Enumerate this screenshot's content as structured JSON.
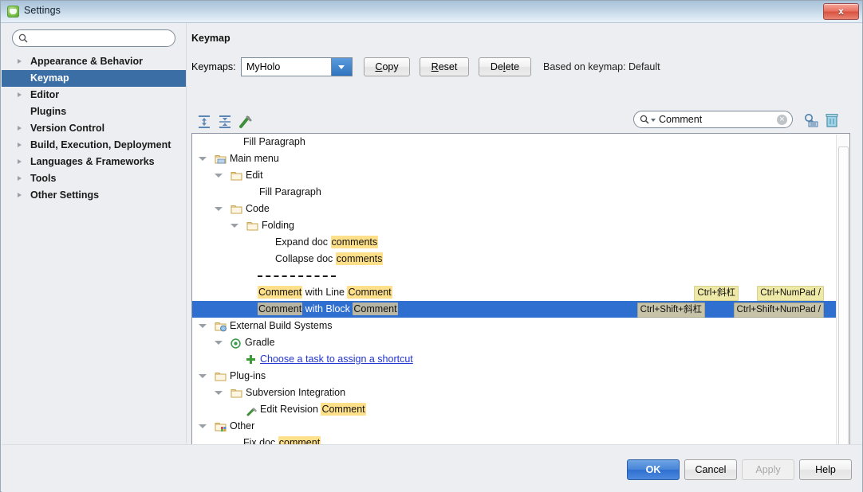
{
  "window": {
    "title": "Settings",
    "icon": "app-icon",
    "close_label": "x"
  },
  "sidebar": {
    "search_placeholder": "",
    "search_value": "",
    "items": [
      {
        "label": "Appearance & Behavior",
        "expandable": true,
        "selected": false
      },
      {
        "label": "Keymap",
        "expandable": false,
        "selected": true
      },
      {
        "label": "Editor",
        "expandable": true,
        "selected": false
      },
      {
        "label": "Plugins",
        "expandable": false,
        "selected": false
      },
      {
        "label": "Version Control",
        "expandable": true,
        "selected": false
      },
      {
        "label": "Build, Execution, Deployment",
        "expandable": true,
        "selected": false
      },
      {
        "label": "Languages & Frameworks",
        "expandable": true,
        "selected": false
      },
      {
        "label": "Tools",
        "expandable": true,
        "selected": false
      },
      {
        "label": "Other Settings",
        "expandable": true,
        "selected": false
      }
    ]
  },
  "main": {
    "page_title": "Keymap",
    "keymaps_label": "Keymaps:",
    "keymap_value": "MyHolo",
    "buttons": {
      "copy": "Copy",
      "reset": "Reset",
      "delete": "Delete"
    },
    "based_on": "Based on keymap: Default",
    "toolbar": {
      "expand_all": "expand-all-icon",
      "collapse_all": "collapse-all-icon",
      "edit_shortcut": "edit-shortcut-icon",
      "find_by_shortcut": "find-by-shortcut-icon",
      "reset_shortcuts": "trash-icon"
    },
    "search": {
      "value": "Comment",
      "clear": "×"
    }
  },
  "tree": {
    "rows": [
      {
        "indent": 64,
        "text": "Fill Paragraph",
        "highlight": null,
        "type": "action",
        "selected": false
      },
      {
        "indent": 8,
        "text": "Main menu",
        "highlight": null,
        "type": "group-menu",
        "expanded": true,
        "selected": false
      },
      {
        "indent": 28,
        "text": "Edit",
        "highlight": null,
        "type": "folder",
        "expanded": true,
        "selected": false
      },
      {
        "indent": 84,
        "text": "Fill Paragraph",
        "highlight": null,
        "type": "action",
        "selected": false
      },
      {
        "indent": 28,
        "text": "Code",
        "highlight": null,
        "type": "folder",
        "expanded": true,
        "selected": false
      },
      {
        "indent": 48,
        "text": "Folding",
        "highlight": null,
        "type": "folder",
        "expanded": true,
        "selected": false
      },
      {
        "indent": 104,
        "text": "Expand doc comments",
        "highlight": "comments",
        "type": "action",
        "selected": false
      },
      {
        "indent": 104,
        "text": "Collapse doc comments",
        "highlight": "comments",
        "type": "action",
        "selected": false
      },
      {
        "indent": 82,
        "text": "",
        "highlight": null,
        "type": "separator",
        "selected": false
      },
      {
        "indent": 82,
        "text": "Comment with Line Comment",
        "highlight": "Comment",
        "type": "action",
        "selected": false,
        "shortcuts": [
          "Ctrl+斜杠",
          "Ctrl+NumPad /"
        ]
      },
      {
        "indent": 82,
        "text": "Comment with Block Comment",
        "highlight": "Comment",
        "type": "action",
        "selected": true,
        "shortcuts": [
          "Ctrl+Shift+斜杠",
          "Ctrl+Shift+NumPad /"
        ]
      },
      {
        "indent": 8,
        "text": "External Build Systems",
        "highlight": null,
        "type": "group-build",
        "expanded": true,
        "selected": false
      },
      {
        "indent": 28,
        "text": "Gradle",
        "highlight": null,
        "type": "gradle",
        "expanded": true,
        "selected": false
      },
      {
        "indent": 68,
        "text": "Choose a task to assign a shortcut",
        "highlight": null,
        "type": "link",
        "selected": false
      },
      {
        "indent": 8,
        "text": "Plug-ins",
        "highlight": null,
        "type": "folder",
        "expanded": true,
        "selected": false
      },
      {
        "indent": 28,
        "text": "Subversion Integration",
        "highlight": null,
        "type": "folder",
        "expanded": true,
        "selected": false
      },
      {
        "indent": 68,
        "text": "Edit Revision Comment",
        "highlight": "Comment",
        "type": "pencil-action",
        "selected": false
      },
      {
        "indent": 8,
        "text": "Other",
        "highlight": null,
        "type": "group-other",
        "expanded": true,
        "selected": false
      },
      {
        "indent": 64,
        "text": "Fix doc comment",
        "highlight": "comment",
        "type": "action",
        "selected": false
      }
    ]
  },
  "footer": {
    "ok": "OK",
    "cancel": "Cancel",
    "apply": "Apply",
    "help": "Help"
  },
  "colors": {
    "selection": "#2f6fd0",
    "nav_selection": "#3a6ea5",
    "highlight": "#ffe08a",
    "shortcut_bg": "#efe9a8",
    "link": "#2033d0"
  }
}
